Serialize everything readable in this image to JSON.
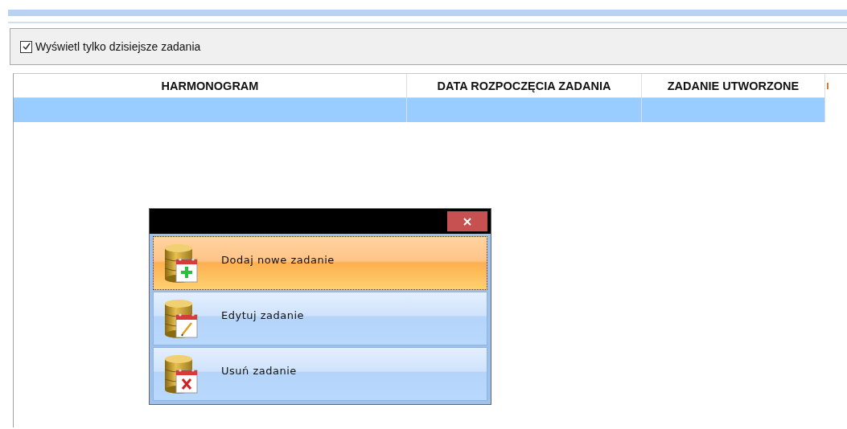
{
  "filter": {
    "label": "Wyświetl tylko dzisiejsze zadania",
    "checked": true
  },
  "table": {
    "columns": [
      "HARMONOGRAM",
      "DATA ROZPOCZĘCIA ZADANIA",
      "ZADANIE UTWORZONE"
    ],
    "rows": [
      {
        "selected": true
      }
    ]
  },
  "popup": {
    "items": [
      {
        "label": "Dodaj nowe zadanie",
        "kind": "add",
        "selected": true
      },
      {
        "label": "Edytuj zadanie",
        "kind": "edit",
        "selected": false
      },
      {
        "label": "Usuń zadanie",
        "kind": "delete",
        "selected": false
      }
    ]
  }
}
